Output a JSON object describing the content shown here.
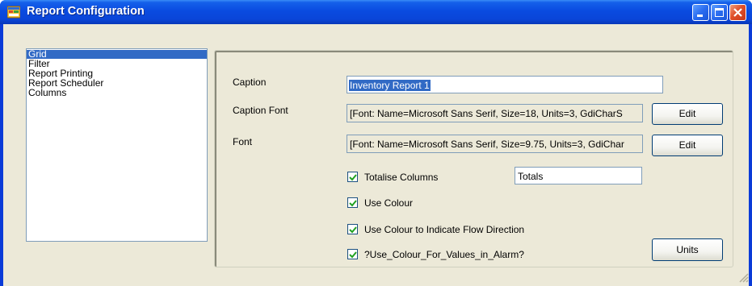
{
  "window": {
    "title": "Report Configuration"
  },
  "sidebar": {
    "items": [
      {
        "label": "Grid",
        "selected": true
      },
      {
        "label": "Filter",
        "selected": false
      },
      {
        "label": "Report Printing",
        "selected": false
      },
      {
        "label": "Report Scheduler",
        "selected": false
      },
      {
        "label": "Columns",
        "selected": false
      }
    ]
  },
  "form": {
    "caption_label": "Caption",
    "caption_value": "Inventory Report 1",
    "caption_font_label": "Caption Font",
    "caption_font_value": "[Font: Name=Microsoft Sans Serif, Size=18, Units=3, GdiCharS",
    "font_label": "Font",
    "font_value": "[Font: Name=Microsoft Sans Serif, Size=9.75, Units=3, GdiChar",
    "edit_label": "Edit",
    "totalise_label": "Totalise Columns",
    "totals_value": "Totals",
    "use_colour_label": "Use Colour",
    "flow_direction_label": "Use Colour to Indicate Flow Direction",
    "alarm_label": "?Use_Colour_For_Values_in_Alarm?",
    "units_label": "Units"
  },
  "colors": {
    "titlebar": "#0a4be0",
    "selection": "#316ac5",
    "face": "#ece9d8"
  }
}
